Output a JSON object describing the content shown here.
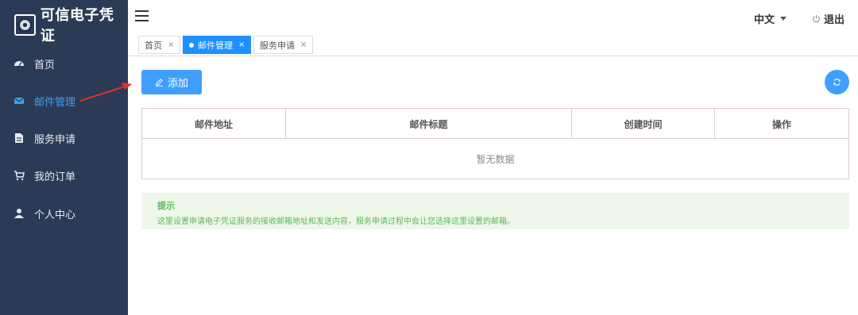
{
  "app": {
    "title": "可信电子凭证"
  },
  "sidebar": {
    "items": [
      {
        "label": "首页",
        "icon": "dashboard-icon",
        "active": false
      },
      {
        "label": "邮件管理",
        "icon": "envelope-icon",
        "active": true
      },
      {
        "label": "服务申请",
        "icon": "document-icon",
        "active": false
      },
      {
        "label": "我的订单",
        "icon": "cart-icon",
        "active": false
      },
      {
        "label": "个人中心",
        "icon": "user-icon",
        "active": false
      }
    ]
  },
  "header": {
    "language": "中文",
    "logout": "退出"
  },
  "tabs": [
    {
      "label": "首页",
      "close": "×",
      "active": false
    },
    {
      "label": "邮件管理",
      "close": "×",
      "active": true
    },
    {
      "label": "服务申请",
      "close": "×",
      "active": false
    }
  ],
  "toolbar": {
    "add_label": "添加"
  },
  "table": {
    "columns": [
      "邮件地址",
      "邮件标题",
      "创建时间",
      "操作"
    ],
    "empty_text": "暂无数据"
  },
  "tip": {
    "title": "提示",
    "text": "这里设置申请电子凭证服务的接收邮箱地址和发送内容，服务申请过程中会让您选择这里设置的邮箱。"
  },
  "colors": {
    "sidebar_bg": "#2c3b55",
    "accent": "#409eff",
    "active_menu": "#3aa0f0",
    "tip_bg": "#eef7ea",
    "tip_text": "#5cb85c",
    "annotation_arrow": "#e03030"
  }
}
